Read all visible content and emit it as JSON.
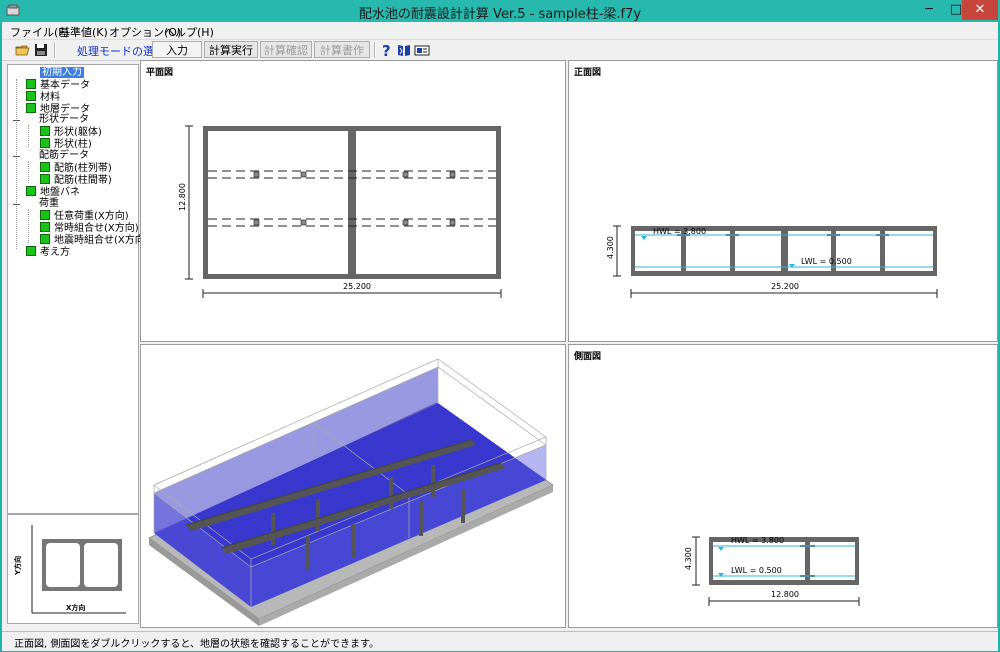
{
  "window": {
    "title": "配水池の耐震設計計算 Ver.5 - sample柱-梁.f7y",
    "minimize_glyph": "─",
    "maximize_glyph": "□",
    "close_glyph": "✕"
  },
  "menu": [
    "ファイル(F)",
    "基準値(K)",
    "オプション(O)",
    "ヘルプ(H)"
  ],
  "toolbar": {
    "mode_label": "処理モードの選択",
    "buttons": [
      "入力",
      "計算実行",
      "計算確認",
      "計算書作成"
    ],
    "disabled": [
      false,
      false,
      true,
      true
    ],
    "icons": [
      "open-folder-icon",
      "save-icon",
      "help-icon",
      "book-icon",
      "card-icon"
    ]
  },
  "tree": {
    "items": [
      {
        "label": "初期入力",
        "level": 1,
        "marker": "none",
        "selected": true
      },
      {
        "label": "基本データ",
        "level": 1,
        "marker": "green"
      },
      {
        "label": "材料",
        "level": 1,
        "marker": "green"
      },
      {
        "label": "地層データ",
        "level": 1,
        "marker": "green"
      },
      {
        "label": "形状データ",
        "level": 1,
        "marker": "expander"
      },
      {
        "label": "形状(躯体)",
        "level": 2,
        "marker": "green"
      },
      {
        "label": "形状(柱)",
        "level": 2,
        "marker": "green"
      },
      {
        "label": "配筋データ",
        "level": 1,
        "marker": "expander"
      },
      {
        "label": "配筋(柱列帯)",
        "level": 2,
        "marker": "green"
      },
      {
        "label": "配筋(柱間帯)",
        "level": 2,
        "marker": "green"
      },
      {
        "label": "地盤バネ",
        "level": 1,
        "marker": "green"
      },
      {
        "label": "荷重",
        "level": 1,
        "marker": "expander"
      },
      {
        "label": "任意荷重(X方向)",
        "level": 2,
        "marker": "green"
      },
      {
        "label": "常時組合せ(X方向)",
        "level": 2,
        "marker": "green"
      },
      {
        "label": "地震時組合せ(X方向)",
        "level": 2,
        "marker": "green"
      },
      {
        "label": "考え方",
        "level": 1,
        "marker": "green"
      }
    ]
  },
  "preview": {
    "y_axis": "Y方向",
    "x_axis": "X方向"
  },
  "panels": {
    "plan": {
      "title": "平面図",
      "width_dim": "25.200",
      "depth_dim": "12.800"
    },
    "front": {
      "title": "正面図",
      "width_dim": "25.200",
      "height_dim": "4.300",
      "hwl": "HWL = 3.800",
      "lwl": "LWL = 0.500"
    },
    "side": {
      "title": "側面図",
      "width_dim": "12.800",
      "height_dim": "4.300",
      "hwl": "HWL = 3.800",
      "lwl": "LWL = 0.500"
    },
    "iso": {
      "title": ""
    }
  },
  "colors": {
    "titlebar": "#27b8ae",
    "water": "#2a2ad0",
    "water_line": "#29b7e6",
    "concrete": "#555555",
    "tree_marker": "#18c418",
    "close_button": "#c7453b"
  },
  "status": "正面図, 側面図をダブルクリックすると、地層の状態を確認することができます。"
}
